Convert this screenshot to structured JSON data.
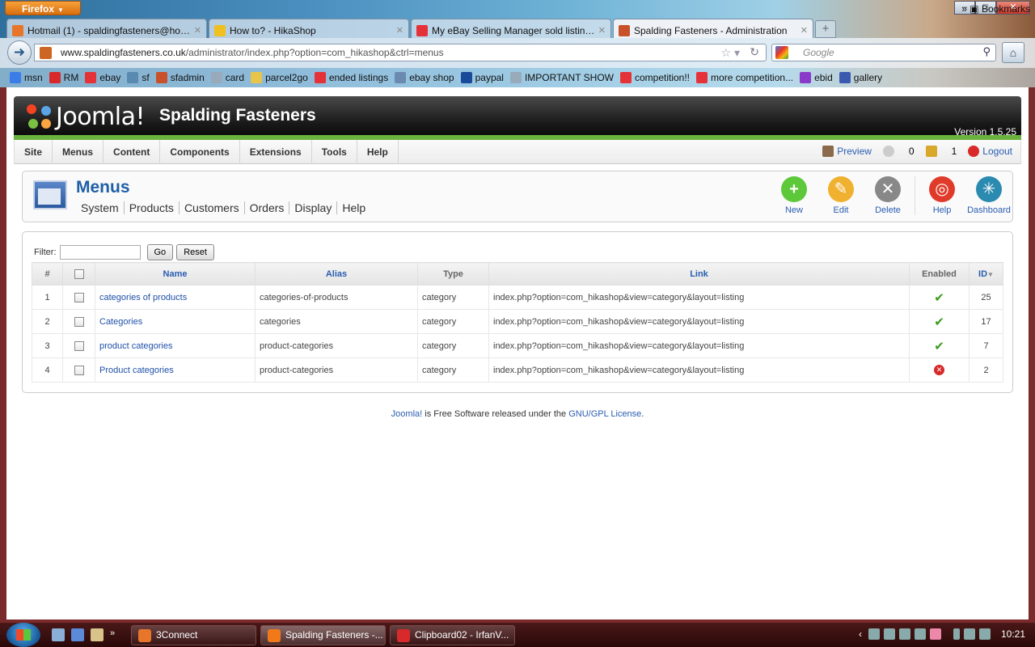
{
  "browser": {
    "app_button": "Firefox",
    "tabs": [
      {
        "label": "Hotmail (1) - spaldingfasteners@hot...",
        "color": "#e8762a"
      },
      {
        "label": "How to? - HikaShop",
        "color": "#f0c020"
      },
      {
        "label": "My eBay Selling Manager sold listings...",
        "color": "#e53238"
      },
      {
        "label": "Spalding Fasteners - Administration",
        "color": "#c8502a"
      }
    ],
    "url_host": "www.spaldingfasteners.co.uk",
    "url_path": "/administrator/index.php?option=com_hikashop&ctrl=menus",
    "search_placeholder": "Google",
    "bookmarks": [
      {
        "label": "msn",
        "color": "#3a7de8"
      },
      {
        "label": "RM",
        "color": "#d8282a"
      },
      {
        "label": "ebay",
        "color": "#e53238"
      },
      {
        "label": "sf",
        "color": "#5a8ab0"
      },
      {
        "label": "sfadmin",
        "color": "#c8502a"
      },
      {
        "label": "card",
        "color": "#9ab"
      },
      {
        "label": "parcel2go",
        "color": "#e8c44a"
      },
      {
        "label": "ended listings",
        "color": "#e53238"
      },
      {
        "label": "ebay shop",
        "color": "#6a8ab0"
      },
      {
        "label": "paypal",
        "color": "#1a4a9a"
      },
      {
        "label": "IMPORTANT SHOW",
        "color": "#9ab"
      },
      {
        "label": "competition!!",
        "color": "#e53238"
      },
      {
        "label": "more competition...",
        "color": "#e53238"
      },
      {
        "label": "ebid",
        "color": "#8a3ac8"
      },
      {
        "label": "gallery",
        "color": "#3a5ab0"
      }
    ],
    "bookmarks_menu": "Bookmarks"
  },
  "joomla": {
    "logo_text": "Joomla!",
    "site_name": "Spalding Fasteners",
    "version": "Version 1.5.25",
    "menu": [
      "Site",
      "Menus",
      "Content",
      "Components",
      "Extensions",
      "Tools",
      "Help"
    ],
    "status": {
      "preview": "Preview",
      "messages": "0",
      "users": "1",
      "logout": "Logout"
    },
    "page_title": "Menus",
    "submenu": [
      "System",
      "Products",
      "Customers",
      "Orders",
      "Display",
      "Help"
    ],
    "toolbar": [
      {
        "label": "New",
        "icon": "plus-icon",
        "color": "#5cc83a",
        "glyph": "+"
      },
      {
        "label": "Edit",
        "icon": "pencil-icon",
        "color": "#f0b030",
        "glyph": "✎"
      },
      {
        "label": "Delete",
        "icon": "trash-icon",
        "color": "#888888",
        "glyph": "✕"
      },
      {
        "label": "Help",
        "icon": "lifebuoy-icon",
        "color": "#e03a2a",
        "glyph": "◎"
      },
      {
        "label": "Dashboard",
        "icon": "dashboard-icon",
        "color": "#2a8ab0",
        "glyph": "✳"
      }
    ],
    "filter": {
      "label": "Filter:",
      "value": "",
      "go": "Go",
      "reset": "Reset"
    },
    "columns": {
      "num": "#",
      "name": "Name",
      "alias": "Alias",
      "type": "Type",
      "link": "Link",
      "enabled": "Enabled",
      "id": "ID"
    },
    "rows": [
      {
        "num": "1",
        "name": "categories of products",
        "alias": "categories-of-products",
        "type": "category",
        "link": "index.php?option=com_hikashop&view=category&layout=listing",
        "enabled": true,
        "id": "25"
      },
      {
        "num": "2",
        "name": "Categories",
        "alias": "categories",
        "type": "category",
        "link": "index.php?option=com_hikashop&view=category&layout=listing",
        "enabled": true,
        "id": "17"
      },
      {
        "num": "3",
        "name": "product categories",
        "alias": "product-categories",
        "type": "category",
        "link": "index.php?option=com_hikashop&view=category&layout=listing",
        "enabled": true,
        "id": "7"
      },
      {
        "num": "4",
        "name": "Product categories",
        "alias": "product-categories",
        "type": "category",
        "link": "index.php?option=com_hikashop&view=category&layout=listing",
        "enabled": false,
        "id": "2"
      }
    ],
    "footer": {
      "joomla_link": "Joomla!",
      "mid": " is Free Software released under the ",
      "license_link": "GNU/GPL License",
      "end": "."
    }
  },
  "taskbar": {
    "tasks": [
      {
        "label": "3Connect",
        "color": "#e8762a",
        "active": false
      },
      {
        "label": "Spalding Fasteners -...",
        "color": "#f07a1a",
        "active": true
      },
      {
        "label": "Clipboard02 - IrfanV...",
        "color": "#d82a2a",
        "active": false
      }
    ],
    "clock": "10:21"
  }
}
